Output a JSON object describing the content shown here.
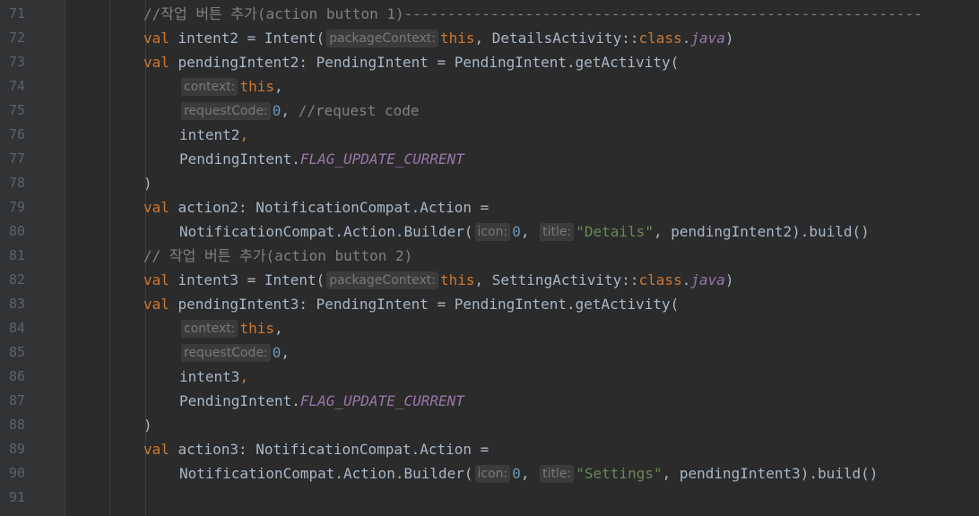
{
  "editor": {
    "lines": [
      {
        "n": "71",
        "indent": false,
        "tokens": [
          {
            "c": "cm",
            "t": "//작업 버튼 추가(action button 1)"
          },
          {
            "c": "dash",
            "t": "------------------------------------------------------------"
          }
        ]
      },
      {
        "n": "72",
        "indent": false,
        "tokens": [
          {
            "c": "kw",
            "t": "val "
          },
          {
            "c": "fn",
            "t": "intent2 = Intent("
          },
          {
            "c": "hint",
            "t": "packageContext:"
          },
          {
            "c": "kw",
            "t": "this"
          },
          {
            "c": "fn",
            "t": ", DetailsActivity::"
          },
          {
            "c": "kw",
            "t": "class"
          },
          {
            "c": "fn",
            "t": "."
          },
          {
            "c": "field",
            "t": "java"
          },
          {
            "c": "fn",
            "t": ")"
          }
        ]
      },
      {
        "n": "73",
        "indent": false,
        "tokens": [
          {
            "c": "kw",
            "t": "val "
          },
          {
            "c": "fn",
            "t": "pendingIntent2: PendingIntent = PendingIntent.getActivity("
          }
        ]
      },
      {
        "n": "74",
        "indent": true,
        "tokens": [
          {
            "c": "hint",
            "t": "context:"
          },
          {
            "c": "kw",
            "t": "this"
          },
          {
            "c": "fn",
            "t": ","
          }
        ]
      },
      {
        "n": "75",
        "indent": true,
        "tokens": [
          {
            "c": "hint",
            "t": "requestCode:"
          },
          {
            "c": "num",
            "t": "0"
          },
          {
            "c": "fn",
            "t": ", "
          },
          {
            "c": "cm",
            "t": "//request code"
          }
        ]
      },
      {
        "n": "76",
        "indent": true,
        "tokens": [
          {
            "c": "fn",
            "t": "intent2"
          },
          {
            "c": "kw",
            "t": ","
          }
        ]
      },
      {
        "n": "77",
        "indent": true,
        "tokens": [
          {
            "c": "fn",
            "t": "PendingIntent."
          },
          {
            "c": "field",
            "t": "FLAG_UPDATE_CURRENT"
          }
        ]
      },
      {
        "n": "78",
        "indent": false,
        "tokens": [
          {
            "c": "fn",
            "t": ")"
          }
        ]
      },
      {
        "n": "79",
        "indent": false,
        "tokens": [
          {
            "c": "kw",
            "t": "val "
          },
          {
            "c": "fn",
            "t": "action2: NotificationCompat.Action ="
          }
        ]
      },
      {
        "n": "80",
        "indent": true,
        "tokens": [
          {
            "c": "fn",
            "t": "NotificationCompat.Action.Builder("
          },
          {
            "c": "hint",
            "t": "icon:"
          },
          {
            "c": "num",
            "t": "0"
          },
          {
            "c": "fn",
            "t": ", "
          },
          {
            "c": "hint",
            "t": "title:"
          },
          {
            "c": "str",
            "t": "\"Details\""
          },
          {
            "c": "fn",
            "t": ", pendingIntent2).build()"
          }
        ]
      },
      {
        "n": "81",
        "indent": false,
        "tokens": [
          {
            "c": "cm",
            "t": "// 작업 버튼 추가(action button 2)"
          }
        ]
      },
      {
        "n": "82",
        "indent": false,
        "tokens": [
          {
            "c": "kw",
            "t": "val "
          },
          {
            "c": "fn",
            "t": "intent3 = Intent("
          },
          {
            "c": "hint",
            "t": "packageContext:"
          },
          {
            "c": "kw",
            "t": "this"
          },
          {
            "c": "fn",
            "t": ", SettingActivity::"
          },
          {
            "c": "kw",
            "t": "class"
          },
          {
            "c": "fn",
            "t": "."
          },
          {
            "c": "field",
            "t": "java"
          },
          {
            "c": "fn",
            "t": ")"
          }
        ]
      },
      {
        "n": "83",
        "indent": false,
        "tokens": [
          {
            "c": "kw",
            "t": "val "
          },
          {
            "c": "fn",
            "t": "pendingIntent3: PendingIntent = PendingIntent.getActivity("
          }
        ]
      },
      {
        "n": "84",
        "indent": true,
        "tokens": [
          {
            "c": "hint",
            "t": "context:"
          },
          {
            "c": "kw",
            "t": "this"
          },
          {
            "c": "fn",
            "t": ","
          }
        ]
      },
      {
        "n": "85",
        "indent": true,
        "tokens": [
          {
            "c": "hint",
            "t": "requestCode:"
          },
          {
            "c": "num",
            "t": "0"
          },
          {
            "c": "fn",
            "t": ","
          }
        ]
      },
      {
        "n": "86",
        "indent": true,
        "tokens": [
          {
            "c": "fn",
            "t": "intent3"
          },
          {
            "c": "kw",
            "t": ","
          }
        ]
      },
      {
        "n": "87",
        "indent": true,
        "tokens": [
          {
            "c": "fn",
            "t": "PendingIntent."
          },
          {
            "c": "field",
            "t": "FLAG_UPDATE_CURRENT"
          }
        ]
      },
      {
        "n": "88",
        "indent": false,
        "tokens": [
          {
            "c": "fn",
            "t": ")"
          }
        ]
      },
      {
        "n": "89",
        "indent": false,
        "tokens": [
          {
            "c": "kw",
            "t": "val "
          },
          {
            "c": "fn",
            "t": "action3: NotificationCompat.Action ="
          }
        ]
      },
      {
        "n": "90",
        "indent": true,
        "tokens": [
          {
            "c": "fn",
            "t": "NotificationCompat.Action.Builder("
          },
          {
            "c": "hint",
            "t": "icon:"
          },
          {
            "c": "num",
            "t": "0"
          },
          {
            "c": "fn",
            "t": ", "
          },
          {
            "c": "hint",
            "t": "title:"
          },
          {
            "c": "str",
            "t": "\"Settings\""
          },
          {
            "c": "fn",
            "t": ", pendingIntent3).build()"
          }
        ]
      },
      {
        "n": "91",
        "indent": false,
        "tokens": []
      }
    ]
  },
  "colors": {
    "background": "#2b2b2b",
    "gutter": "#313335",
    "keyword": "#cc7832",
    "default": "#a9b7c6",
    "comment": "#808080",
    "number": "#6897bb",
    "string": "#6a8759",
    "field": "#9876aa",
    "line_number": "#606366"
  }
}
